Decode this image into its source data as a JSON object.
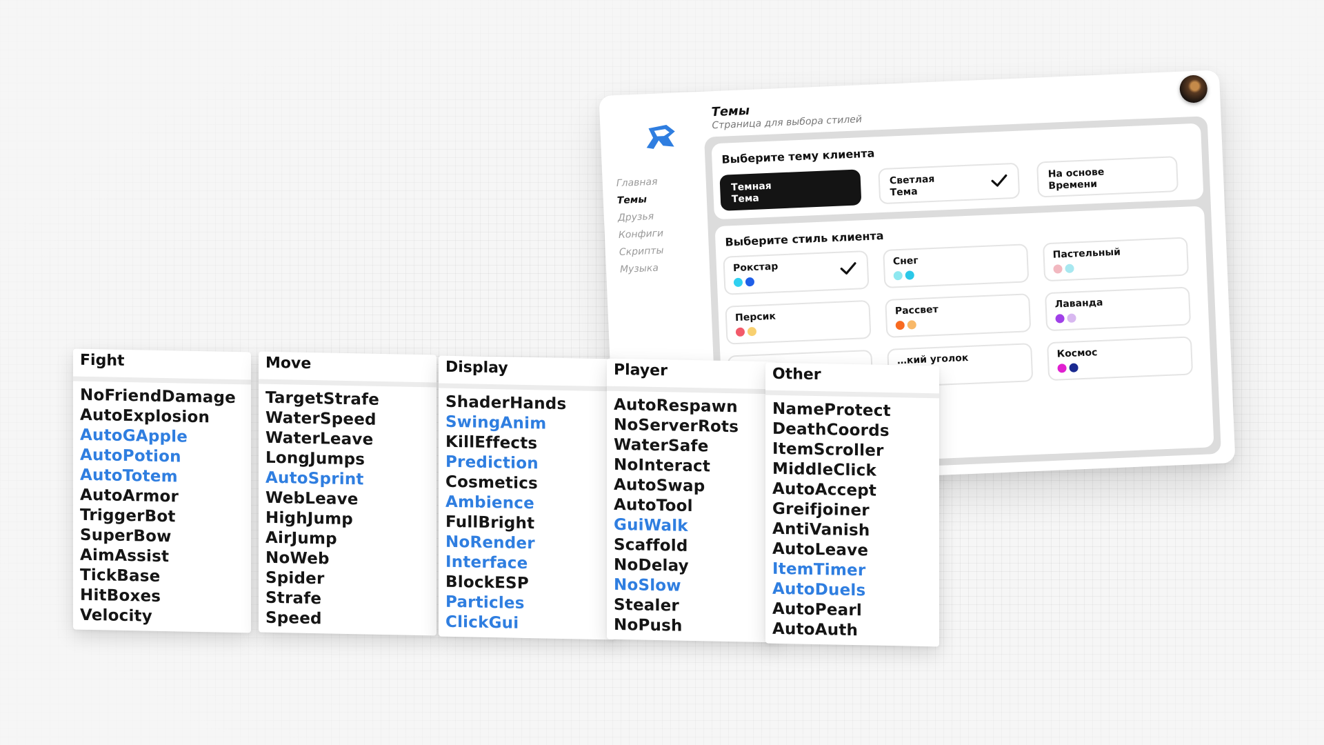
{
  "theme_window": {
    "title": "Темы",
    "subtitle": "Страница для выбора стилей",
    "nav": [
      "Главная",
      "Темы",
      "Друзья",
      "Конфиги",
      "Скрипты",
      "Музыка"
    ],
    "active_nav": "Темы",
    "theme_section": {
      "label": "Выберите тему клиента",
      "options": [
        {
          "line1": "Темная",
          "line2": "Тема",
          "style": "dark",
          "checked": false
        },
        {
          "line1": "Светлая",
          "line2": "Тема",
          "style": "light",
          "checked": true
        },
        {
          "line1": "На основе",
          "line2": "Времени",
          "style": "light",
          "checked": false
        }
      ]
    },
    "style_section": {
      "label": "Выберите стиль клиента",
      "styles": [
        {
          "name": "Рокстар",
          "colors": [
            "#2fd0f0",
            "#1f5fe8"
          ],
          "checked": true
        },
        {
          "name": "Снег",
          "colors": [
            "#8ee8f0",
            "#2bc8e8"
          ],
          "checked": false
        },
        {
          "name": "Пастельный",
          "colors": [
            "#f2b8c0",
            "#a8e8f0"
          ],
          "checked": false
        },
        {
          "name": "Персик",
          "colors": [
            "#f25a6a",
            "#f8d070"
          ],
          "checked": false
        },
        {
          "name": "Рассвет",
          "colors": [
            "#f86a20",
            "#f8b868"
          ],
          "checked": false
        },
        {
          "name": "Лаванда",
          "colors": [
            "#a040e8",
            "#d8b8f0"
          ],
          "checked": false
        },
        {
          "name": "",
          "colors": [],
          "checked": false
        },
        {
          "name": "…кий уголок",
          "colors": [],
          "checked": false
        },
        {
          "name": "Космос",
          "colors": [
            "#e020d0",
            "#1a2a90"
          ],
          "checked": false
        }
      ]
    }
  },
  "modules": [
    {
      "category": "Fight",
      "items": [
        {
          "name": "NoFriendDamage",
          "enabled": false
        },
        {
          "name": "AutoExplosion",
          "enabled": false
        },
        {
          "name": "AutoGApple",
          "enabled": true
        },
        {
          "name": "AutoPotion",
          "enabled": true
        },
        {
          "name": "AutoTotem",
          "enabled": true
        },
        {
          "name": "AutoArmor",
          "enabled": false
        },
        {
          "name": "TriggerBot",
          "enabled": false
        },
        {
          "name": "SuperBow",
          "enabled": false
        },
        {
          "name": "AimAssist",
          "enabled": false
        },
        {
          "name": "TickBase",
          "enabled": false
        },
        {
          "name": "HitBoxes",
          "enabled": false
        },
        {
          "name": "Velocity",
          "enabled": false
        }
      ]
    },
    {
      "category": "Move",
      "items": [
        {
          "name": "TargetStrafe",
          "enabled": false
        },
        {
          "name": "WaterSpeed",
          "enabled": false
        },
        {
          "name": "WaterLeave",
          "enabled": false
        },
        {
          "name": "LongJumps",
          "enabled": false
        },
        {
          "name": "AutoSprint",
          "enabled": true
        },
        {
          "name": "WebLeave",
          "enabled": false
        },
        {
          "name": "HighJump",
          "enabled": false
        },
        {
          "name": "AirJump",
          "enabled": false
        },
        {
          "name": "NoWeb",
          "enabled": false
        },
        {
          "name": "Spider",
          "enabled": false
        },
        {
          "name": "Strafe",
          "enabled": false
        },
        {
          "name": "Speed",
          "enabled": false
        }
      ]
    },
    {
      "category": "Display",
      "items": [
        {
          "name": "ShaderHands",
          "enabled": false
        },
        {
          "name": "SwingAnim",
          "enabled": true
        },
        {
          "name": "KillEffects",
          "enabled": false
        },
        {
          "name": "Prediction",
          "enabled": true
        },
        {
          "name": "Cosmetics",
          "enabled": false
        },
        {
          "name": "Ambience",
          "enabled": true
        },
        {
          "name": "FullBright",
          "enabled": false
        },
        {
          "name": "NoRender",
          "enabled": true
        },
        {
          "name": "Interface",
          "enabled": true
        },
        {
          "name": "BlockESP",
          "enabled": false
        },
        {
          "name": "Particles",
          "enabled": true
        },
        {
          "name": "ClickGui",
          "enabled": true
        }
      ]
    },
    {
      "category": "Player",
      "items": [
        {
          "name": "AutoRespawn",
          "enabled": false
        },
        {
          "name": "NoServerRots",
          "enabled": false
        },
        {
          "name": "WaterSafe",
          "enabled": false
        },
        {
          "name": "NoInteract",
          "enabled": false
        },
        {
          "name": "AutoSwap",
          "enabled": false
        },
        {
          "name": "AutoTool",
          "enabled": false
        },
        {
          "name": "GuiWalk",
          "enabled": true
        },
        {
          "name": "Scaffold",
          "enabled": false
        },
        {
          "name": "NoDelay",
          "enabled": false
        },
        {
          "name": "NoSlow",
          "enabled": true
        },
        {
          "name": "Stealer",
          "enabled": false
        },
        {
          "name": "NoPush",
          "enabled": false
        }
      ]
    },
    {
      "category": "Other",
      "items": [
        {
          "name": "NameProtect",
          "enabled": false
        },
        {
          "name": "DeathCoords",
          "enabled": false
        },
        {
          "name": "ItemScroller",
          "enabled": false
        },
        {
          "name": "MiddleClick",
          "enabled": false
        },
        {
          "name": "AutoAccept",
          "enabled": false
        },
        {
          "name": "Greifjoiner",
          "enabled": false
        },
        {
          "name": "AntiVanish",
          "enabled": false
        },
        {
          "name": "AutoLeave",
          "enabled": false
        },
        {
          "name": "ItemTimer",
          "enabled": true
        },
        {
          "name": "AutoDuels",
          "enabled": true
        },
        {
          "name": "AutoPearl",
          "enabled": false
        },
        {
          "name": "AutoAuth",
          "enabled": false
        }
      ]
    }
  ]
}
